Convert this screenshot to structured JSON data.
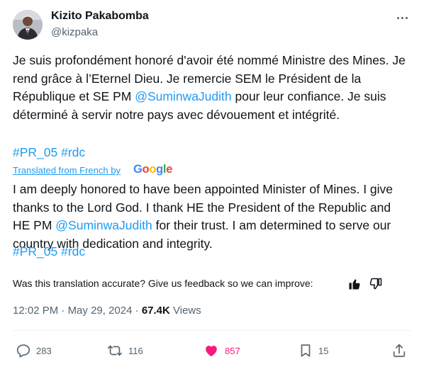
{
  "author": {
    "name": "Kizito Pakabomba",
    "handle": "@kizpaka"
  },
  "tweet": {
    "original": {
      "part1": "Je suis profondément honoré d'avoir été nommé Ministre des Mines. Je rend grâce à l’Eternel Dieu. Je remercie SEM le Président de la République et SE PM ",
      "mention": "@SuminwaJudith",
      "part2": " pour leur confiance. Je suis déterminé à servir notre pays avec dévouement et intégrité.",
      "hashtag1": "#PR_05",
      "hashtag2": "#rdc"
    },
    "translated_from": "Translated from French by",
    "google": [
      "G",
      "o",
      "o",
      "g",
      "l",
      "e"
    ],
    "translation": {
      "part1": "I am deeply honored to have been appointed Minister of Mines. I give thanks to the Lord God. I thank HE the President of the Republic and HE PM ",
      "mention": "@SuminwaJudith",
      "part2": " for their trust. I am determined to serve our country with dedication and integrity.",
      "hashtag1": "#PR_05",
      "hashtag2": "#rdc"
    },
    "feedback_prompt": "Was this translation accurate? Give us feedback so we can improve:",
    "time": "12:02 PM",
    "date": "May 29, 2024",
    "views_count": "67.4K",
    "views_label": "Views"
  },
  "actions": {
    "replies": "283",
    "reposts": "116",
    "likes": "857",
    "bookmarks": "15"
  },
  "colors": {
    "accent": "#1d9bf0",
    "like": "#f91880",
    "secondary_text": "#536471"
  },
  "icons": [
    "more-icon",
    "google-logo",
    "thumbs-up-icon",
    "thumbs-down-icon",
    "reply-icon",
    "repost-icon",
    "like-icon",
    "bookmark-icon",
    "share-icon"
  ]
}
